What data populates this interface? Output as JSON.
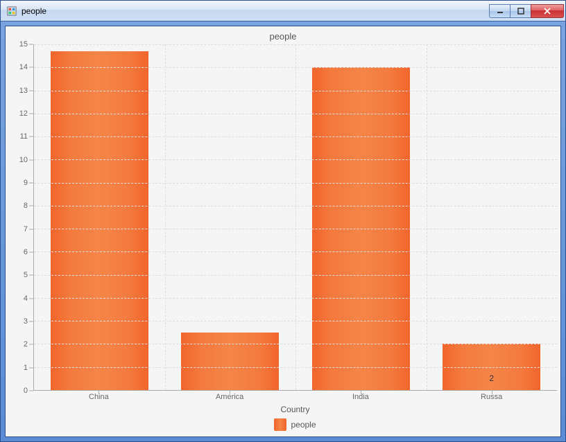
{
  "window": {
    "title": "people"
  },
  "chart_data": {
    "type": "bar",
    "title": "people",
    "xlabel": "Country",
    "ylabel": "",
    "categories": [
      "China",
      "America",
      "India",
      "Russa"
    ],
    "values": [
      14.7,
      2.5,
      14.0,
      2.0
    ],
    "data_labels": [
      "",
      "",
      "",
      "2"
    ],
    "ylim": [
      0,
      15
    ],
    "y_ticks": [
      0,
      1,
      2,
      3,
      4,
      5,
      6,
      7,
      8,
      9,
      10,
      11,
      12,
      13,
      14,
      15
    ],
    "legend": [
      "people"
    ],
    "series_color": "#f4712e"
  }
}
